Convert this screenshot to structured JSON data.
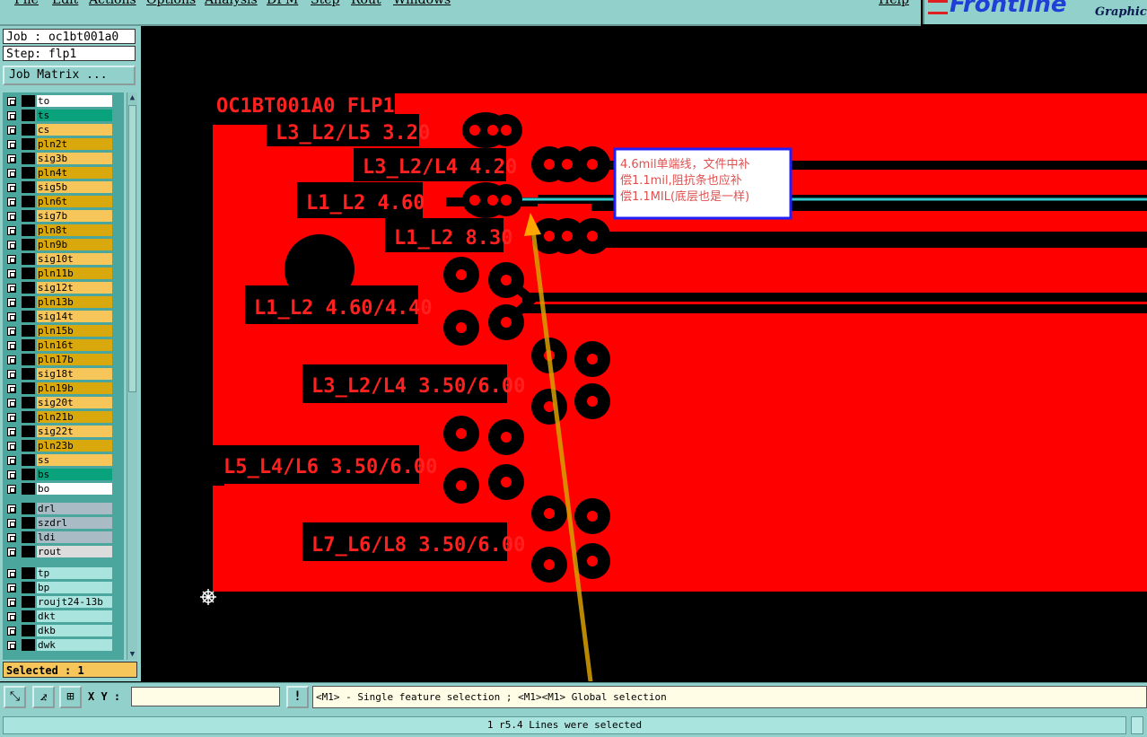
{
  "menubar": {
    "items": [
      "File",
      "Edit",
      "Actions",
      "Options",
      "Analysis",
      "DFM",
      "Step",
      "Rout",
      "Windows"
    ],
    "help": "Help"
  },
  "brand": {
    "logo": "Frontline",
    "subtitle": "Graphic E"
  },
  "sidebar": {
    "job": "Job : oc1bt001a0",
    "step": "Step: flp1",
    "job_matrix_button": "Job Matrix ...",
    "selected": "Selected : 1"
  },
  "layers": {
    "group_board": [
      {
        "name": "to",
        "color": "#ffffff"
      },
      {
        "name": "ts",
        "color": "#0aa27c"
      },
      {
        "name": "cs",
        "color": "#f6c65a"
      },
      {
        "name": "pln2t",
        "color": "#d9a80d"
      },
      {
        "name": "sig3b",
        "color": "#f6c65a"
      },
      {
        "name": "pln4t",
        "color": "#d9a80d"
      },
      {
        "name": "sig5b",
        "color": "#f6c65a"
      },
      {
        "name": "pln6t",
        "color": "#d9a80d"
      },
      {
        "name": "sig7b",
        "color": "#f6c65a"
      },
      {
        "name": "pln8t",
        "color": "#d9a80d"
      },
      {
        "name": "pln9b",
        "color": "#d9a80d"
      },
      {
        "name": "sig10t",
        "color": "#f6c65a"
      },
      {
        "name": "pln11b",
        "color": "#d9a80d"
      },
      {
        "name": "sig12t",
        "color": "#f6c65a"
      },
      {
        "name": "pln13b",
        "color": "#d9a80d"
      },
      {
        "name": "sig14t",
        "color": "#f6c65a"
      },
      {
        "name": "pln15b",
        "color": "#d9a80d"
      },
      {
        "name": "pln16t",
        "color": "#d9a80d"
      },
      {
        "name": "pln17b",
        "color": "#d9a80d"
      },
      {
        "name": "sig18t",
        "color": "#f6c65a"
      },
      {
        "name": "pln19b",
        "color": "#d9a80d"
      },
      {
        "name": "sig20t",
        "color": "#f6c65a"
      },
      {
        "name": "pln21b",
        "color": "#d9a80d"
      },
      {
        "name": "sig22t",
        "color": "#f6c65a"
      },
      {
        "name": "pln23b",
        "color": "#d9a80d"
      },
      {
        "name": "ss",
        "color": "#f6c65a"
      },
      {
        "name": "bs",
        "color": "#0aa27c"
      },
      {
        "name": "bo",
        "color": "#ffffff"
      }
    ],
    "group_drill": [
      {
        "name": "drl",
        "color": "#a9bcc5"
      },
      {
        "name": "szdrl",
        "color": "#a9bcc5"
      },
      {
        "name": "ldi",
        "color": "#a9bcc5"
      },
      {
        "name": "rout",
        "color": "#dcdcdc"
      }
    ],
    "group_misc": [
      {
        "name": "tp",
        "color": "#a9e4de"
      },
      {
        "name": "bp",
        "color": "#a9e4de"
      },
      {
        "name": "roujt24-13b",
        "color": "#a9e4de"
      },
      {
        "name": "dkt",
        "color": "#a9e4de"
      },
      {
        "name": "dkb",
        "color": "#a9e4de"
      },
      {
        "name": "dwk",
        "color": "#a9e4de"
      }
    ]
  },
  "canvas": {
    "title_label": "OC1BT001A0 FLP1",
    "labels": [
      "L3_L2/L5 3.20",
      "L3_L2/L4 4.20",
      "L1_L2 4.60",
      "L1_L2 8.30",
      "L1_L2 4.60/4.40",
      "L3_L2/L4 3.50/6.00",
      "L5_L4/L6 3.50/6.00",
      "L7_L6/L8 3.50/6.00"
    ],
    "annotation": [
      "4.6mil单端线，文件中补",
      "偿1.1mil,阻抗条也应补",
      "偿1.1MIL(底层也是一样)"
    ],
    "colors": {
      "board": "#ff0000",
      "background": "#000000",
      "selected_line": "#33cccc",
      "arrow": "#ffa500",
      "annotation_border": "#2020ff",
      "annotation_text": "#e05050"
    }
  },
  "toolbar": {
    "xy_label": "X Y :",
    "xy_value": "",
    "exclaim": "!",
    "prompt": "<M1> - Single feature selection ; <M1><M1> Global selection"
  },
  "status": "1 r5.4 Lines were selected"
}
